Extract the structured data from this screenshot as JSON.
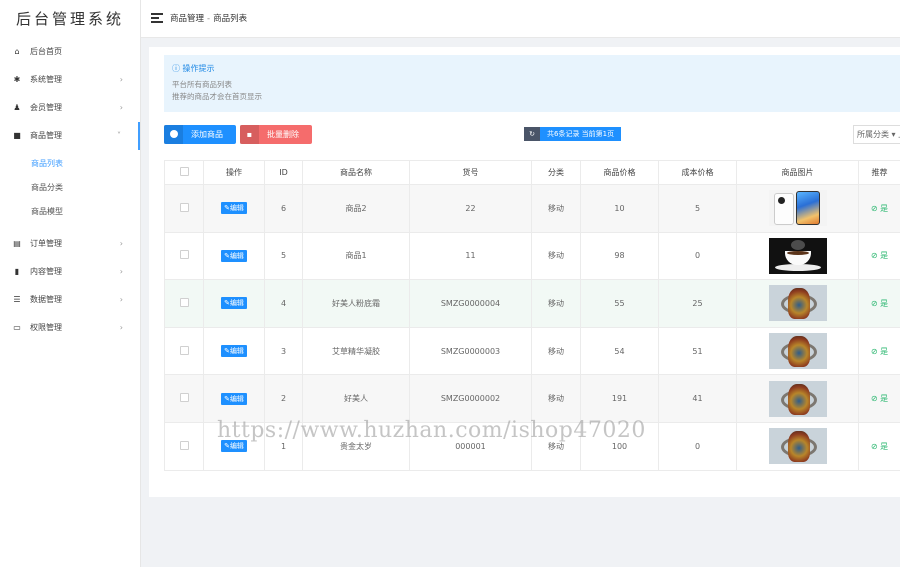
{
  "sidebar": {
    "logo": "后台管理系统",
    "items": [
      {
        "label": "后台首页",
        "icon": "home-icon"
      },
      {
        "label": "系统管理",
        "icon": "gear-icon"
      },
      {
        "label": "会员管理",
        "icon": "users-icon"
      },
      {
        "label": "商品管理",
        "icon": "bag-icon"
      },
      {
        "label": "订单管理",
        "icon": "clipboard-icon"
      },
      {
        "label": "内容管理",
        "icon": "file-icon"
      },
      {
        "label": "数据管理",
        "icon": "database-icon"
      },
      {
        "label": "权限管理",
        "icon": "monitor-icon"
      }
    ],
    "sub_items": [
      "商品列表",
      "商品分类",
      "商品模型"
    ]
  },
  "header": {
    "breadcrumb": [
      "商品管理",
      "商品列表"
    ],
    "separator": "-"
  },
  "tip": {
    "title": "操作提示",
    "lines": [
      "平台所有商品列表",
      "推荐的商品才会在首页显示"
    ]
  },
  "toolbar": {
    "add_label": "添加商品",
    "delete_label": "批量删除",
    "record_text": "共6条记录 当前第1页",
    "filter_label": "所属分类 ▾ 上"
  },
  "table": {
    "headers": [
      "",
      "操作",
      "ID",
      "商品名称",
      "货号",
      "分类",
      "商品价格",
      "成本价格",
      "商品图片",
      "推荐"
    ],
    "edit_label": "编辑",
    "rec_label": "是",
    "rows": [
      {
        "id": "6",
        "name": "商品2",
        "sku": "22",
        "category": "移动",
        "price": "10",
        "cost": "5",
        "image": "phone"
      },
      {
        "id": "5",
        "name": "商品1",
        "sku": "11",
        "category": "移动",
        "price": "98",
        "cost": "0",
        "image": "coffee"
      },
      {
        "id": "4",
        "name": "好美人粉底霜",
        "sku": "SMZG0000004",
        "category": "移动",
        "price": "55",
        "cost": "25",
        "image": "vase"
      },
      {
        "id": "3",
        "name": "艾草精华凝胶",
        "sku": "SMZG0000003",
        "category": "移动",
        "price": "54",
        "cost": "51",
        "image": "vase"
      },
      {
        "id": "2",
        "name": "好美人",
        "sku": "SMZG0000002",
        "category": "移动",
        "price": "191",
        "cost": "41",
        "image": "vase"
      },
      {
        "id": "1",
        "name": "贵金太岁",
        "sku": "000001",
        "category": "移动",
        "price": "100",
        "cost": "0",
        "image": "vase"
      }
    ]
  },
  "watermark": "https://www.huzhan.com/ishop47020",
  "colors": {
    "primary": "#1e90ff",
    "danger": "#f56c6c",
    "success": "#2eb872",
    "tip_bg": "#e8f4fd"
  }
}
